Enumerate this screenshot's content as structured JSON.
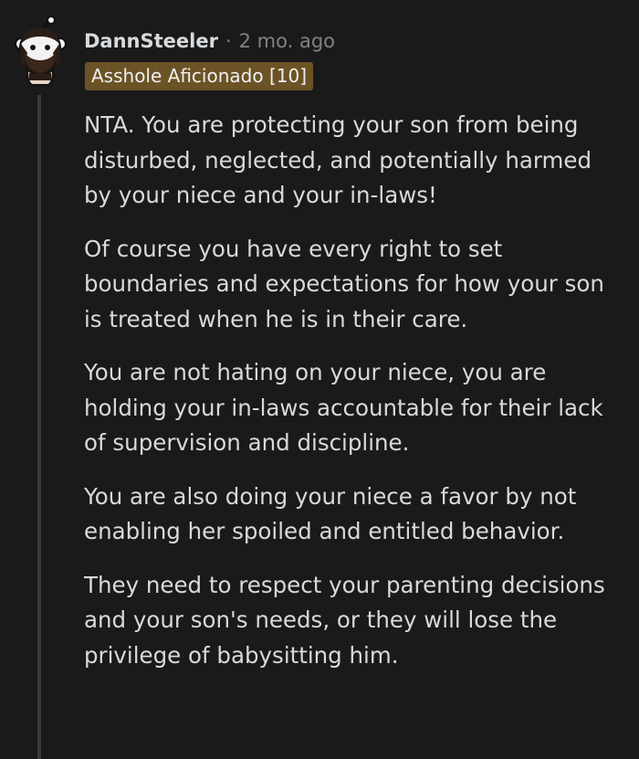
{
  "comment": {
    "username": "DannSteeler",
    "separator": "·",
    "timestamp": "2 mo. ago",
    "flair": "Asshole Aficionado [10]",
    "paragraphs": [
      "NTA. You are protecting your son from being disturbed, neglected, and potentially harmed by your niece and your in-laws!",
      "Of course you have every right to set boundaries and expectations for how your son is treated when he is in their care.",
      "You are not hating on your niece, you are holding your in-laws accountable for their lack of supervision and discipline.",
      "You are also doing your niece a favor by not enabling her spoiled and entitled behavior.",
      "They need to respect your parenting decisions and your son's needs, or they will lose the privilege of babysitting him."
    ]
  },
  "colors": {
    "background": "#1a1a1b",
    "text": "#d7dadc",
    "meta": "#818384",
    "flair_bg": "#6b5325",
    "thread_line": "#3a3a3c"
  },
  "icons": {
    "avatar": "snoo-avatar-icon"
  }
}
